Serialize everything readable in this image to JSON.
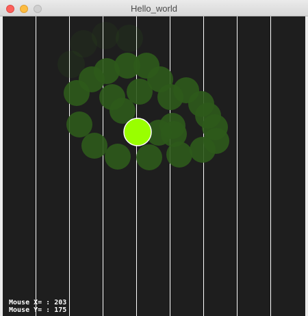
{
  "window": {
    "title": "Hello_world",
    "bg_color": "#1e1e1e",
    "line_color": "#ffffff",
    "trail_color": "#2d5a1b",
    "cursor_color": "#99ff00"
  },
  "mouse_readout": {
    "x_label": "Mouse X= : 203",
    "y_label": "Mouse Y= : 175"
  }
}
